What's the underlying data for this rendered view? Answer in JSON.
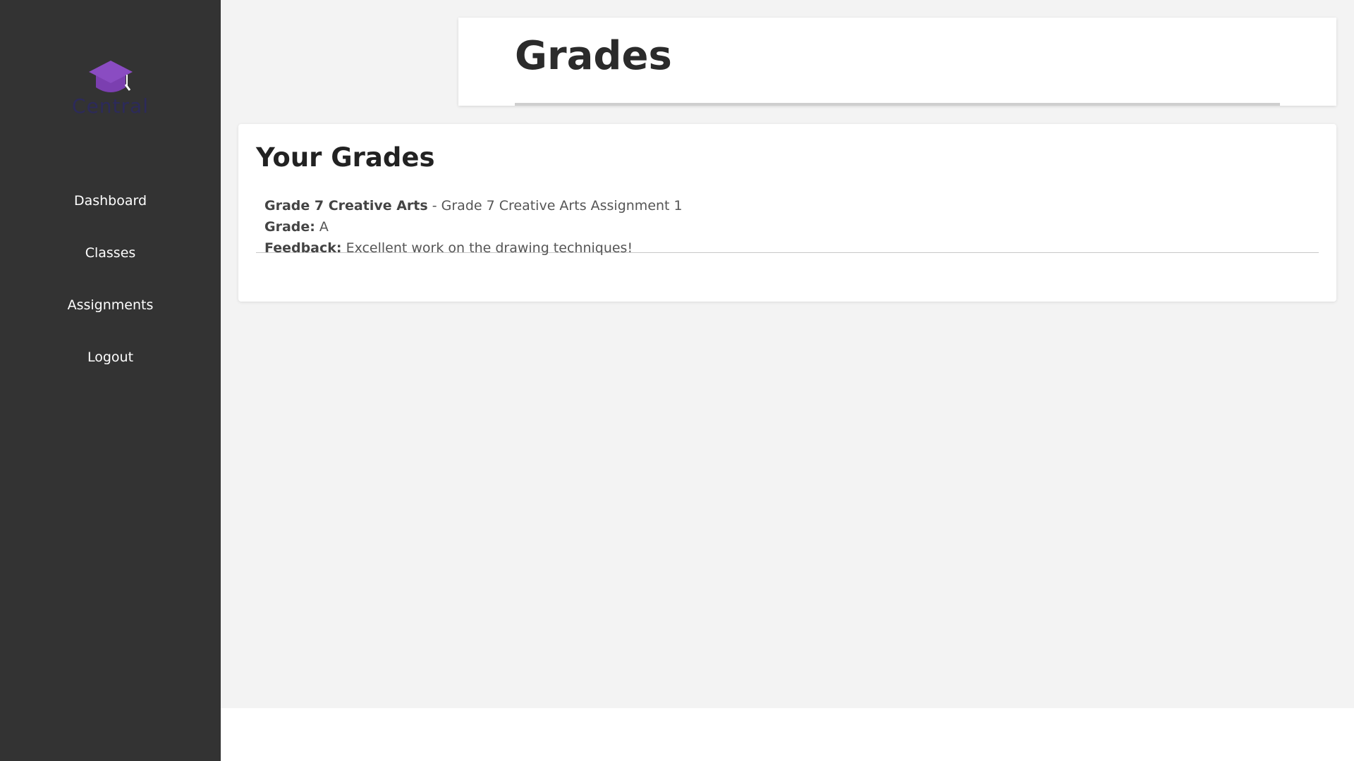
{
  "app": {
    "logo_text": "Central",
    "brand_color": "#7b3fb0"
  },
  "sidebar": {
    "items": [
      {
        "label": "Dashboard",
        "icon": ""
      },
      {
        "label": "Classes",
        "icon": ""
      },
      {
        "label": "Assignments",
        "icon": ""
      },
      {
        "label": "Logout",
        "icon": ""
      }
    ]
  },
  "header": {
    "title": "Grades"
  },
  "grades": {
    "title": "Your Grades",
    "entries": [
      {
        "class_name": "Grade 7 Creative Arts",
        "separator": " - ",
        "assignment": "Grade 7 Creative Arts Assignment 1",
        "grade_label": "Grade:",
        "grade_value": "A",
        "feedback_label": "Feedback:",
        "feedback_value": "Excellent work on the drawing techniques!"
      }
    ]
  },
  "colors": {
    "sidebar_bg": "#333333",
    "main_bg": "#f3f3f3",
    "card_bg": "#ffffff"
  }
}
